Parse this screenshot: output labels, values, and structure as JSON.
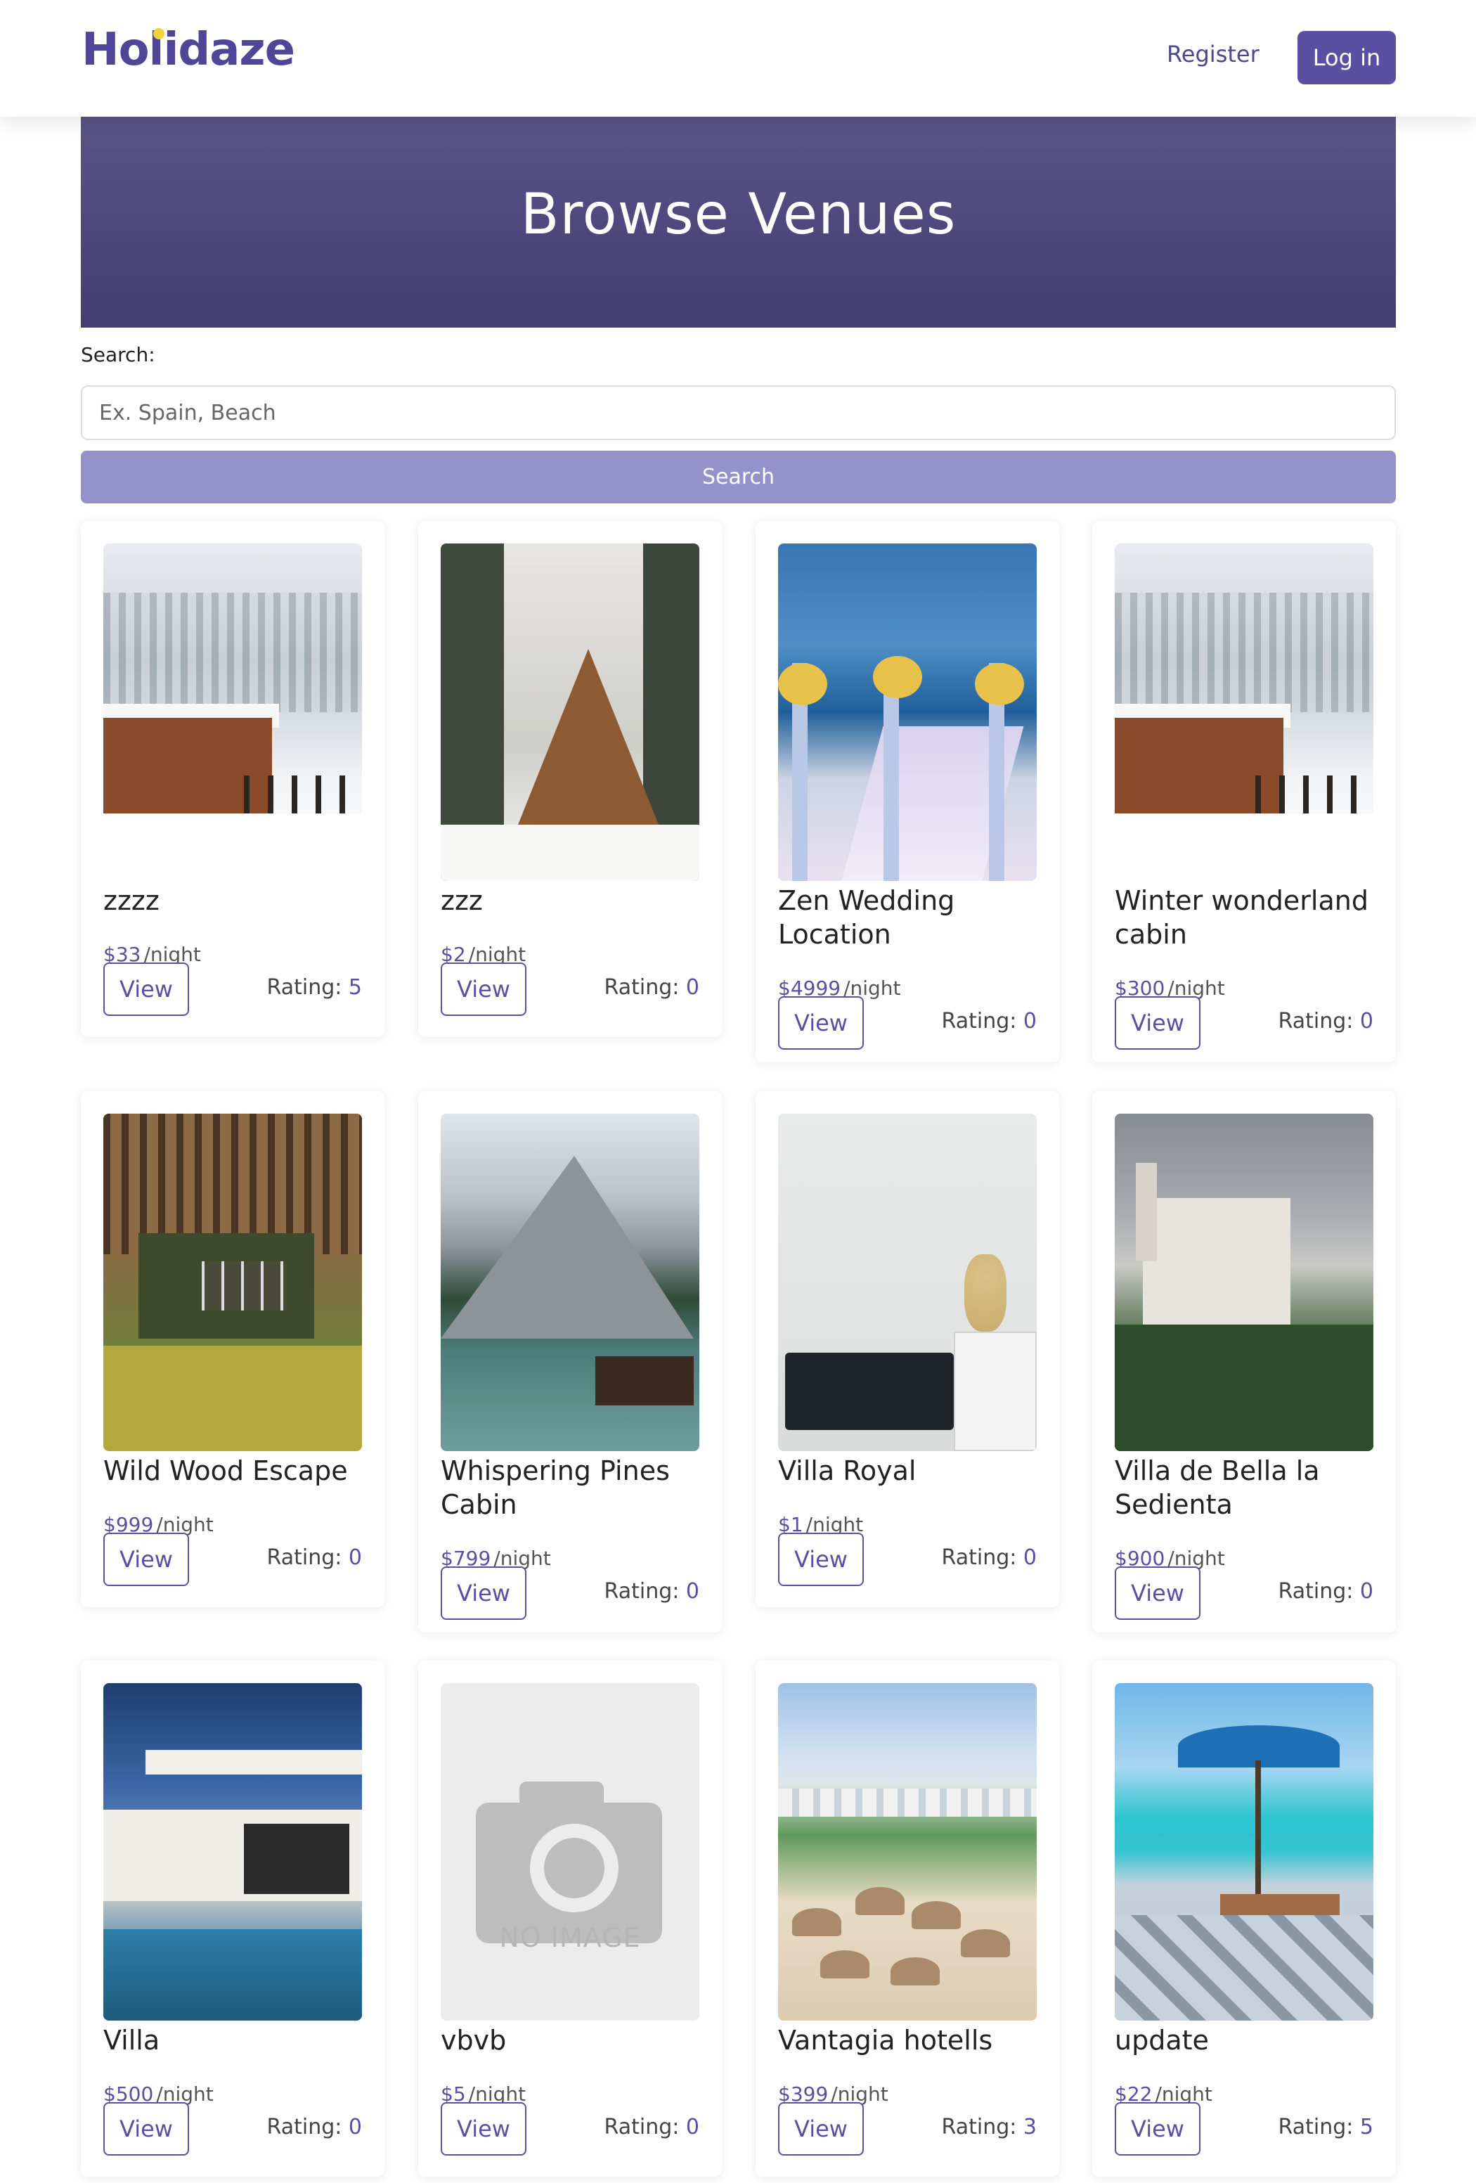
{
  "header": {
    "logo": "Holidaze",
    "register_label": "Register",
    "login_label": "Log in"
  },
  "hero": {
    "title": "Browse Venues"
  },
  "search": {
    "label": "Search:",
    "placeholder": "Ex. Spain, Beach",
    "button_label": "Search"
  },
  "labels": {
    "view": "View",
    "rating_prefix": "Rating: ",
    "per_night": "/night"
  },
  "venues": [
    {
      "name": "zzzz",
      "price": "$33",
      "rating": "5",
      "image": "snowy-chalet"
    },
    {
      "name": "zzz",
      "price": "$2",
      "rating": "0",
      "image": "a-frame-cabin"
    },
    {
      "name": "Zen Wedding Location",
      "price": "$4999",
      "rating": "0",
      "image": "beach-wedding"
    },
    {
      "name": "Winter wonderland cabin",
      "price": "$300",
      "rating": "0",
      "image": "snowy-chalet"
    },
    {
      "name": "Wild Wood Escape",
      "price": "$999",
      "rating": "0",
      "image": "forest-hut"
    },
    {
      "name": "Whispering Pines Cabin",
      "price": "$799",
      "rating": "0",
      "image": "mountain-lake"
    },
    {
      "name": "Villa Royal",
      "price": "$1",
      "rating": "0",
      "image": "living-room"
    },
    {
      "name": "Villa de Bella la Sedienta",
      "price": "$900",
      "rating": "0",
      "image": "castle"
    },
    {
      "name": "Villa",
      "price": "$500",
      "rating": "0",
      "image": "modern-villa"
    },
    {
      "name": "vbvb",
      "price": "$5",
      "rating": "0",
      "image": "no-image-placeholder"
    },
    {
      "name": "Vantagia hotells",
      "price": "$399",
      "rating": "3",
      "image": "beach-resort"
    },
    {
      "name": "update",
      "price": "$22",
      "rating": "5",
      "image": "pool-deck"
    }
  ],
  "no_image_text": "NO IMAGE",
  "colors": {
    "brand": "#4f4697",
    "accent": "#5b4fa2",
    "search_button": "#9591cb",
    "logo_dot": "#f4d23c"
  }
}
